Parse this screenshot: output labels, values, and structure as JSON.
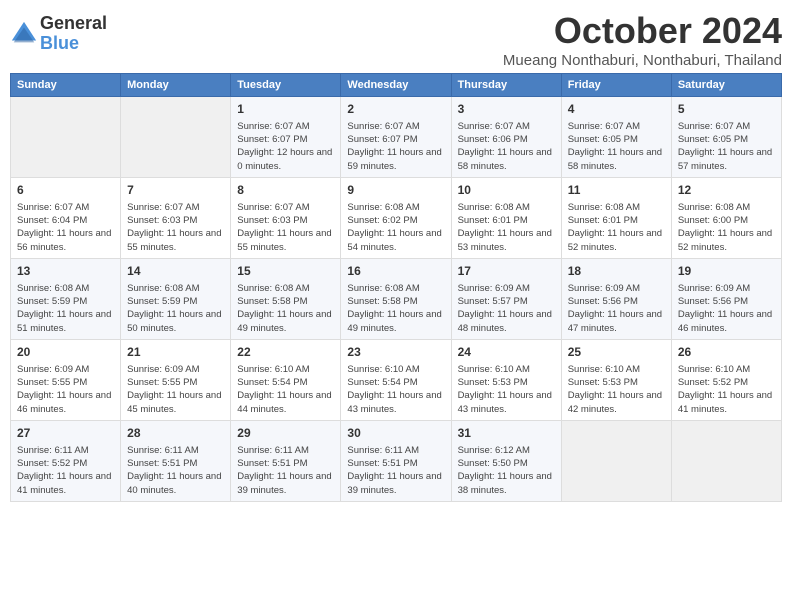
{
  "logo": {
    "general": "General",
    "blue": "Blue"
  },
  "title": "October 2024",
  "location": "Mueang Nonthaburi, Nonthaburi, Thailand",
  "days_header": [
    "Sunday",
    "Monday",
    "Tuesday",
    "Wednesday",
    "Thursday",
    "Friday",
    "Saturday"
  ],
  "weeks": [
    [
      {
        "day": "",
        "info": ""
      },
      {
        "day": "",
        "info": ""
      },
      {
        "day": "1",
        "info": "Sunrise: 6:07 AM\nSunset: 6:07 PM\nDaylight: 12 hours and 0 minutes."
      },
      {
        "day": "2",
        "info": "Sunrise: 6:07 AM\nSunset: 6:07 PM\nDaylight: 11 hours and 59 minutes."
      },
      {
        "day": "3",
        "info": "Sunrise: 6:07 AM\nSunset: 6:06 PM\nDaylight: 11 hours and 58 minutes."
      },
      {
        "day": "4",
        "info": "Sunrise: 6:07 AM\nSunset: 6:05 PM\nDaylight: 11 hours and 58 minutes."
      },
      {
        "day": "5",
        "info": "Sunrise: 6:07 AM\nSunset: 6:05 PM\nDaylight: 11 hours and 57 minutes."
      }
    ],
    [
      {
        "day": "6",
        "info": "Sunrise: 6:07 AM\nSunset: 6:04 PM\nDaylight: 11 hours and 56 minutes."
      },
      {
        "day": "7",
        "info": "Sunrise: 6:07 AM\nSunset: 6:03 PM\nDaylight: 11 hours and 55 minutes."
      },
      {
        "day": "8",
        "info": "Sunrise: 6:07 AM\nSunset: 6:03 PM\nDaylight: 11 hours and 55 minutes."
      },
      {
        "day": "9",
        "info": "Sunrise: 6:08 AM\nSunset: 6:02 PM\nDaylight: 11 hours and 54 minutes."
      },
      {
        "day": "10",
        "info": "Sunrise: 6:08 AM\nSunset: 6:01 PM\nDaylight: 11 hours and 53 minutes."
      },
      {
        "day": "11",
        "info": "Sunrise: 6:08 AM\nSunset: 6:01 PM\nDaylight: 11 hours and 52 minutes."
      },
      {
        "day": "12",
        "info": "Sunrise: 6:08 AM\nSunset: 6:00 PM\nDaylight: 11 hours and 52 minutes."
      }
    ],
    [
      {
        "day": "13",
        "info": "Sunrise: 6:08 AM\nSunset: 5:59 PM\nDaylight: 11 hours and 51 minutes."
      },
      {
        "day": "14",
        "info": "Sunrise: 6:08 AM\nSunset: 5:59 PM\nDaylight: 11 hours and 50 minutes."
      },
      {
        "day": "15",
        "info": "Sunrise: 6:08 AM\nSunset: 5:58 PM\nDaylight: 11 hours and 49 minutes."
      },
      {
        "day": "16",
        "info": "Sunrise: 6:08 AM\nSunset: 5:58 PM\nDaylight: 11 hours and 49 minutes."
      },
      {
        "day": "17",
        "info": "Sunrise: 6:09 AM\nSunset: 5:57 PM\nDaylight: 11 hours and 48 minutes."
      },
      {
        "day": "18",
        "info": "Sunrise: 6:09 AM\nSunset: 5:56 PM\nDaylight: 11 hours and 47 minutes."
      },
      {
        "day": "19",
        "info": "Sunrise: 6:09 AM\nSunset: 5:56 PM\nDaylight: 11 hours and 46 minutes."
      }
    ],
    [
      {
        "day": "20",
        "info": "Sunrise: 6:09 AM\nSunset: 5:55 PM\nDaylight: 11 hours and 46 minutes."
      },
      {
        "day": "21",
        "info": "Sunrise: 6:09 AM\nSunset: 5:55 PM\nDaylight: 11 hours and 45 minutes."
      },
      {
        "day": "22",
        "info": "Sunrise: 6:10 AM\nSunset: 5:54 PM\nDaylight: 11 hours and 44 minutes."
      },
      {
        "day": "23",
        "info": "Sunrise: 6:10 AM\nSunset: 5:54 PM\nDaylight: 11 hours and 43 minutes."
      },
      {
        "day": "24",
        "info": "Sunrise: 6:10 AM\nSunset: 5:53 PM\nDaylight: 11 hours and 43 minutes."
      },
      {
        "day": "25",
        "info": "Sunrise: 6:10 AM\nSunset: 5:53 PM\nDaylight: 11 hours and 42 minutes."
      },
      {
        "day": "26",
        "info": "Sunrise: 6:10 AM\nSunset: 5:52 PM\nDaylight: 11 hours and 41 minutes."
      }
    ],
    [
      {
        "day": "27",
        "info": "Sunrise: 6:11 AM\nSunset: 5:52 PM\nDaylight: 11 hours and 41 minutes."
      },
      {
        "day": "28",
        "info": "Sunrise: 6:11 AM\nSunset: 5:51 PM\nDaylight: 11 hours and 40 minutes."
      },
      {
        "day": "29",
        "info": "Sunrise: 6:11 AM\nSunset: 5:51 PM\nDaylight: 11 hours and 39 minutes."
      },
      {
        "day": "30",
        "info": "Sunrise: 6:11 AM\nSunset: 5:51 PM\nDaylight: 11 hours and 39 minutes."
      },
      {
        "day": "31",
        "info": "Sunrise: 6:12 AM\nSunset: 5:50 PM\nDaylight: 11 hours and 38 minutes."
      },
      {
        "day": "",
        "info": ""
      },
      {
        "day": "",
        "info": ""
      }
    ]
  ]
}
